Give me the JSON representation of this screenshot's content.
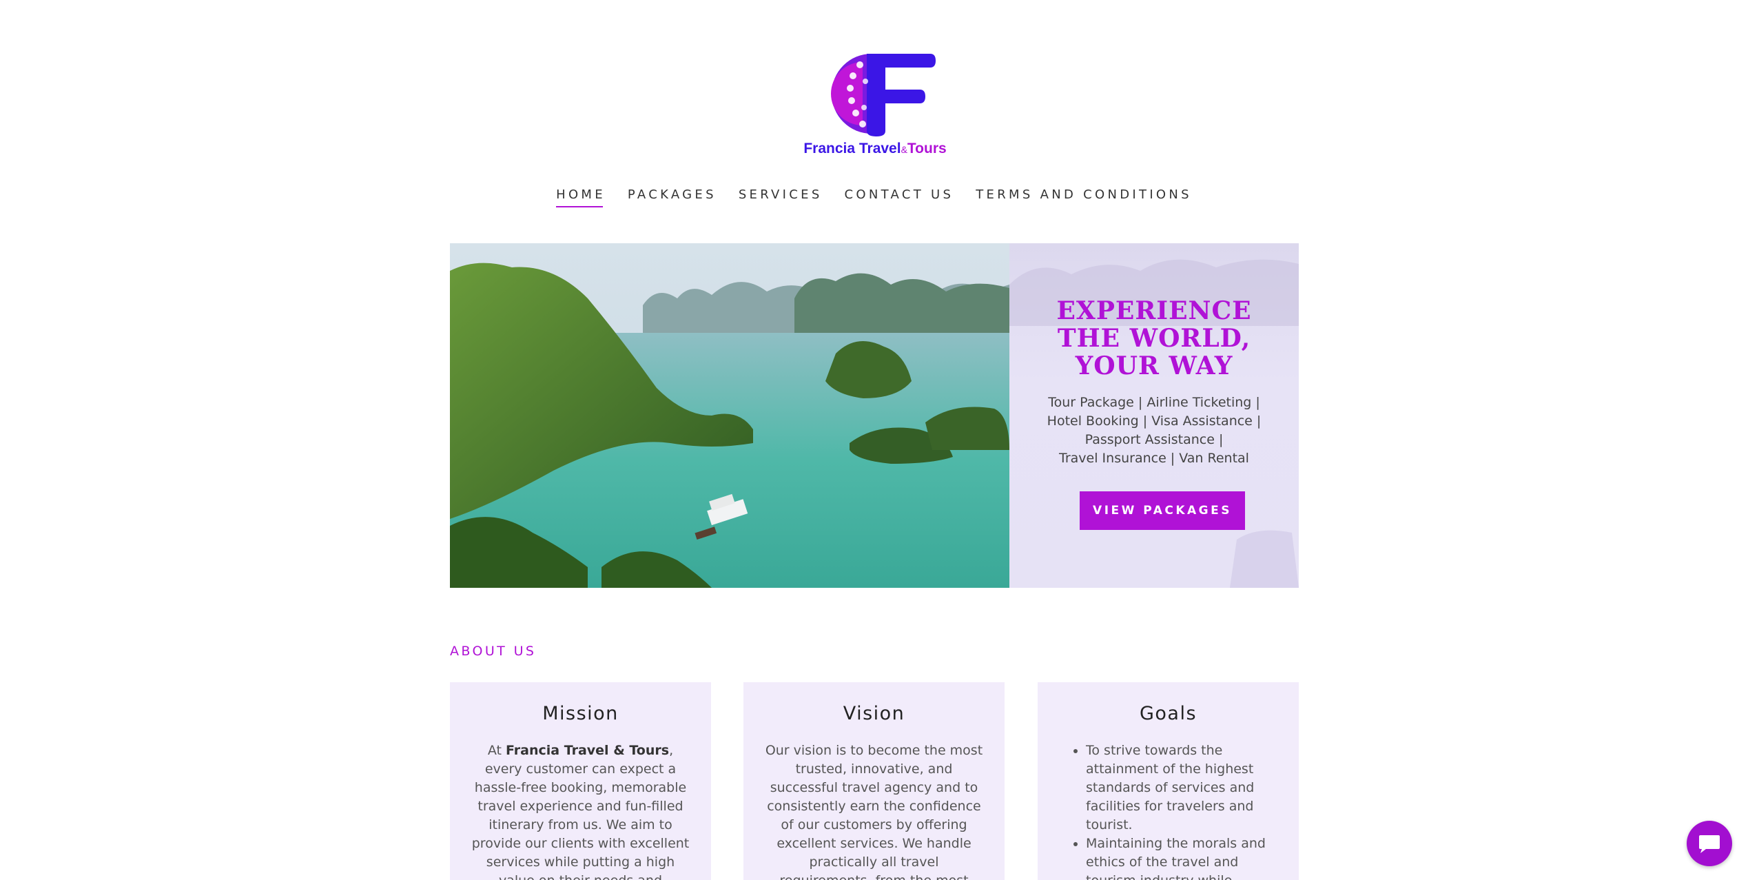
{
  "logo": {
    "text_a": "Francia Travel",
    "text_sep": "&",
    "text_b": "Tours"
  },
  "nav": {
    "items": [
      {
        "label": "HOME",
        "active": true
      },
      {
        "label": "PACKAGES"
      },
      {
        "label": "SERVICES"
      },
      {
        "label": "CONTACT US"
      },
      {
        "label": "TERMS AND CONDITIONS"
      }
    ]
  },
  "hero": {
    "title_line1": "EXPERIENCE",
    "title_line2": "THE WORLD,",
    "title_line3": "YOUR WAY",
    "sub_line1": "Tour Package | Airline Ticketing |",
    "sub_line2": "Hotel Booking | Visa Assistance |",
    "sub_line3": "Passport Assistance |",
    "sub_line4": "Travel Insurance | Van Rental",
    "button_label": "VIEW PACKAGES"
  },
  "about": {
    "label": "ABOUT US",
    "mission": {
      "title": "Mission",
      "text_pre": "At ",
      "text_bold": "Francia Travel & Tours",
      "text_post": ", every customer can expect a hassle-free booking, memorable travel experience and fun-filled itinerary from us. We aim to provide our clients with excellent services while putting a high value on their needs and complete satisfaction."
    },
    "vision": {
      "title": "Vision",
      "text": "Our vision is to become the most trusted, innovative, and successful travel agency and to consistently earn the confidence of our customers by offering excellent services. We handle practically all travel requirements, from the most basic to the most complicated."
    },
    "goals": {
      "title": "Goals",
      "items": [
        "To strive towards the attainment of the highest standards of services and facilities for travelers and tourist.",
        "Maintaining the morals and ethics of the travel and tourism industry while"
      ]
    }
  },
  "colors": {
    "accent": "#b012d6",
    "logo_blue": "#3b16e6",
    "card_bg": "#f2ecfb"
  },
  "icons": {
    "chat": "chat-bubble-icon"
  }
}
